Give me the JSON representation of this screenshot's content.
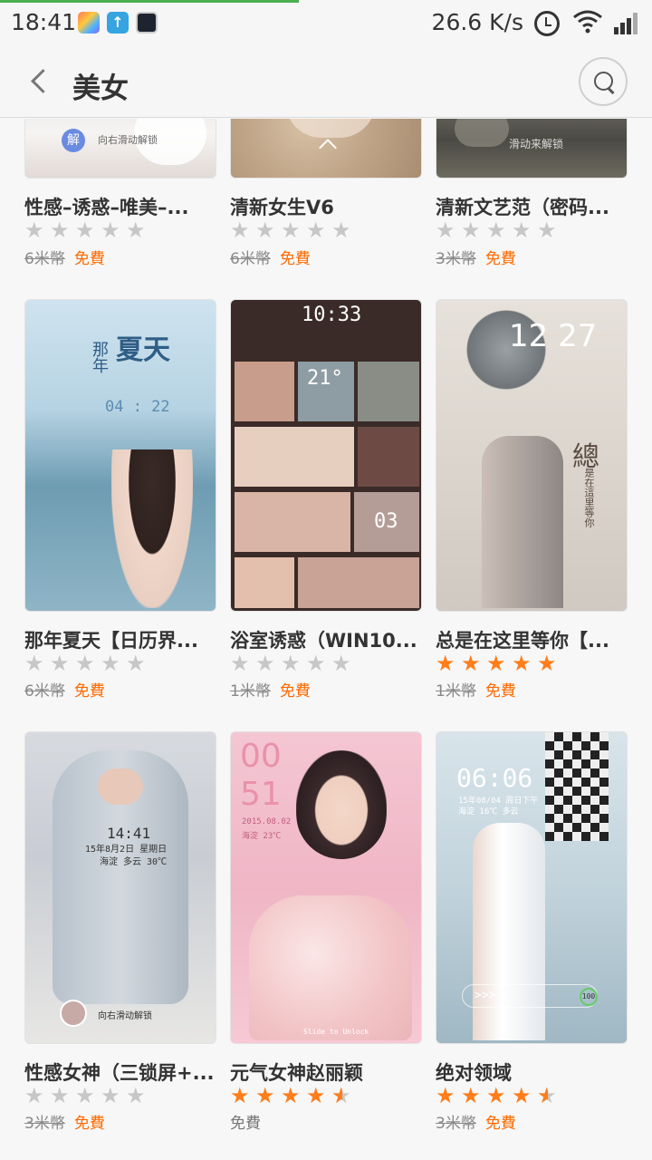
{
  "status_bar": {
    "time": "18:41",
    "speed": "26.6 K/s",
    "icons": [
      "launcher-app-icon",
      "upload-icon",
      "video-app-icon",
      "alarm-icon",
      "wifi-icon",
      "signal-icon"
    ]
  },
  "header": {
    "title": "美女"
  },
  "colors": {
    "accent": "#ff6a00",
    "star_on": "#ff7d1a",
    "star_off": "#c7c7c7"
  },
  "thumb_text": {
    "r1c1": "向右滑动解锁",
    "r1c1_badge": "解",
    "r1c3": "滑动来解锁",
    "r2c1_title": "夏天",
    "r2c1_side": "那年",
    "r2c1_time": "04 : 22",
    "r2c2_time": "10:33",
    "r2c2_temp": "21°",
    "r2c2_num": "03",
    "r2c3_time": "12 27",
    "r2c3_big": "總",
    "r2c3_side": "是在這里等你",
    "r3c1_time": "14:41",
    "r3c1_date": "15年8月2日 星期日",
    "r3c1_loc": "海淀 多云 30℃",
    "r3c1_unlock": "向右滑动解锁",
    "r3c2_hour": "00",
    "r3c2_min": "51",
    "r3c2_date": "2015.08.02",
    "r3c2_weather": "海淀 23℃",
    "r3c2_unlock": "Slide to Unlock",
    "r3c3_time": "06:06",
    "r3c3_date": "15年08/04 周日下午",
    "r3c3_weather": "海淀 16℃ 多云",
    "r3c3_arrows": ">>>",
    "r3c3_badge": "100"
  },
  "items": [
    {
      "title": "性感–诱惑–唯美–...",
      "stars": 0,
      "old_price": "6米幣",
      "price": "免費"
    },
    {
      "title": "清新女生V6",
      "stars": 0,
      "old_price": "6米幣",
      "price": "免費"
    },
    {
      "title": "清新文艺范（密码...",
      "stars": 0,
      "old_price": "3米幣",
      "price": "免費"
    },
    {
      "title": "那年夏天【日历界...",
      "stars": 0,
      "old_price": "6米幣",
      "price": "免費"
    },
    {
      "title": "浴室诱惑（WIN10...",
      "stars": 0,
      "old_price": "1米幣",
      "price": "免費"
    },
    {
      "title": "总是在这里等你【...",
      "stars": 5,
      "old_price": "1米幣",
      "price": "免費"
    },
    {
      "title": "性感女神（三锁屏+...",
      "stars": 0,
      "old_price": "3米幣",
      "price": "免費"
    },
    {
      "title": "元气女神赵丽颖",
      "stars": 4.5,
      "old_price": "",
      "price": "免費"
    },
    {
      "title": "绝对领域",
      "stars": 4.5,
      "old_price": "3米幣",
      "price": "免費"
    }
  ]
}
